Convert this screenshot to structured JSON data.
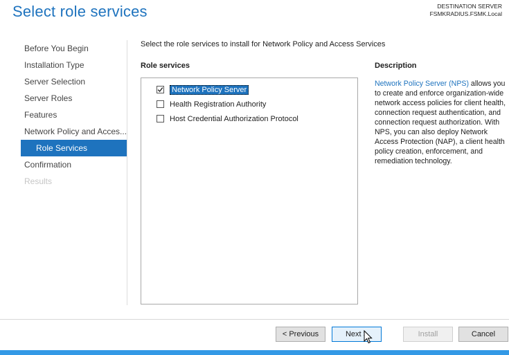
{
  "header": {
    "title": "Select role services",
    "destination_label": "DESTINATION SERVER",
    "destination_server": "FSMKRADIUS.FSMK.Local"
  },
  "nav": {
    "items": [
      {
        "label": "Before You Begin"
      },
      {
        "label": "Installation Type"
      },
      {
        "label": "Server Selection"
      },
      {
        "label": "Server Roles"
      },
      {
        "label": "Features"
      },
      {
        "label": "Network Policy and Acces..."
      },
      {
        "label": "Role Services"
      },
      {
        "label": "Confirmation"
      },
      {
        "label": "Results"
      }
    ],
    "active": "Role Services"
  },
  "main": {
    "instruction": "Select the role services to install for Network Policy and Access Services",
    "role_services_header": "Role services",
    "description_header": "Description",
    "role_services": [
      {
        "label": "Network Policy Server",
        "checked": true,
        "selected": true
      },
      {
        "label": "Health Registration Authority",
        "checked": false
      },
      {
        "label": "Host Credential Authorization Protocol",
        "checked": false
      }
    ],
    "description": {
      "link_text": "Network Policy Server (NPS)",
      "text": " allows you to create and enforce organization-wide network access policies for client health, connection request authentication, and connection request authorization. With NPS, you can also deploy Network Access Protection (NAP), a client health policy creation, enforcement, and remediation technology."
    }
  },
  "footer": {
    "previous_label": "< Previous",
    "next_label": "Next >",
    "install_label": "Install",
    "cancel_label": "Cancel"
  },
  "colors": {
    "accent": "#1e73be",
    "taskbar": "#3399e6"
  }
}
